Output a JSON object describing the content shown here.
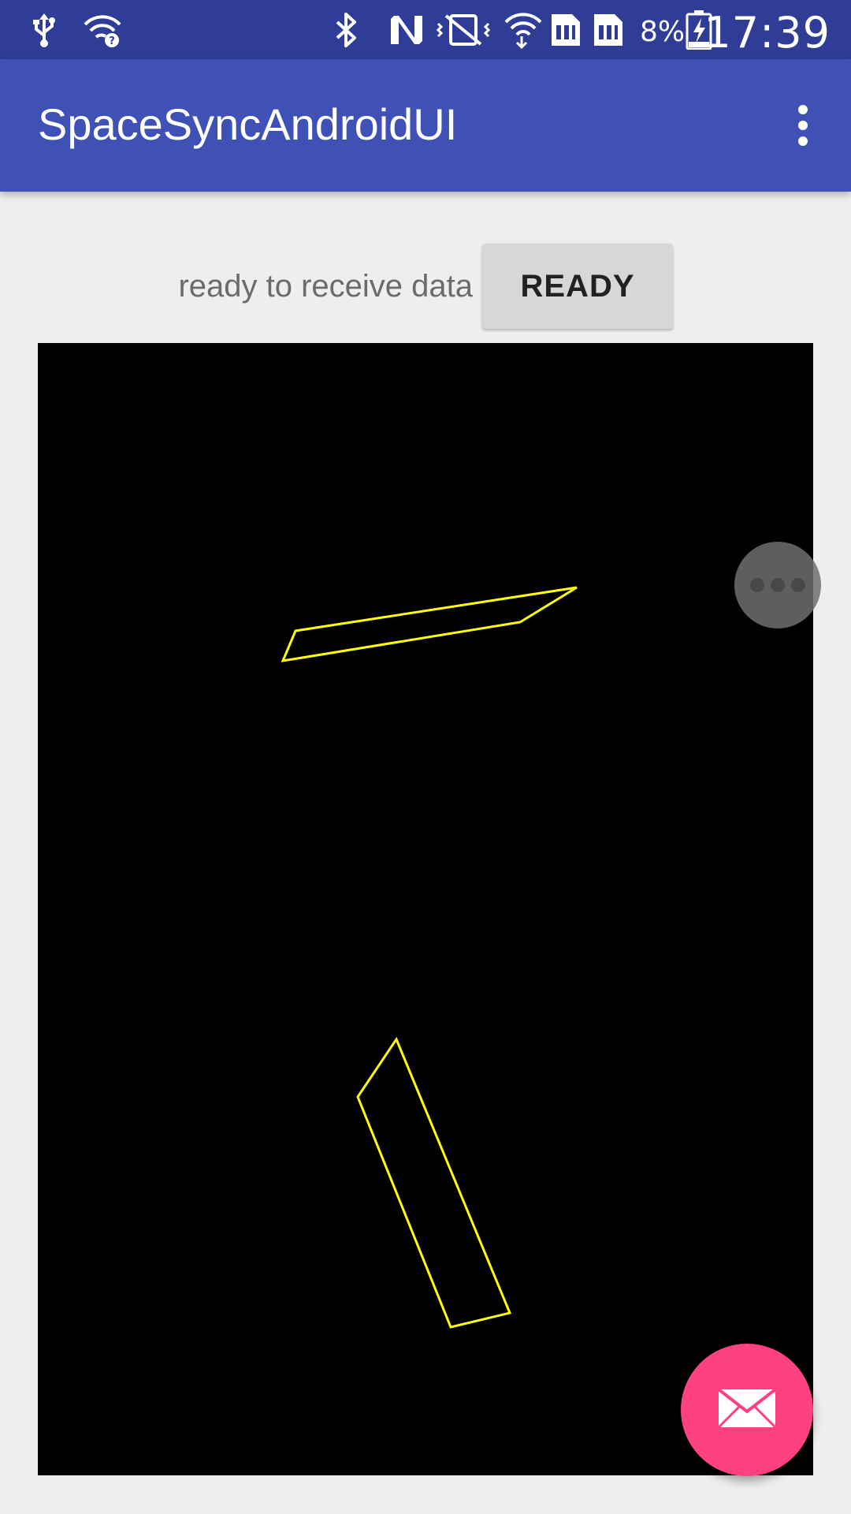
{
  "status_bar": {
    "battery_percent": "8%",
    "time": "17:39",
    "icons": [
      "usb-icon",
      "wifi-question-icon",
      "bluetooth-icon",
      "nfc-icon",
      "vibrate-icon",
      "wifi-icon",
      "sim1-icon",
      "sim2-icon",
      "battery-charging-icon"
    ]
  },
  "app_bar": {
    "title": "SpaceSyncAndroidUI",
    "overflow_icon": "more-vert-icon"
  },
  "status": {
    "label": "ready to receive data",
    "button_label": "READY"
  },
  "canvas": {
    "background": "#000000",
    "stroke_color": "#ffff00"
  },
  "floating_bubble": {
    "icon": "more-horiz-icon"
  },
  "fab": {
    "icon": "mail-icon",
    "color": "#ff4081"
  },
  "colors": {
    "status_bar": "#2f3d97",
    "primary": "#3f51b5",
    "accent": "#ff4081",
    "background": "#eeeeee"
  }
}
